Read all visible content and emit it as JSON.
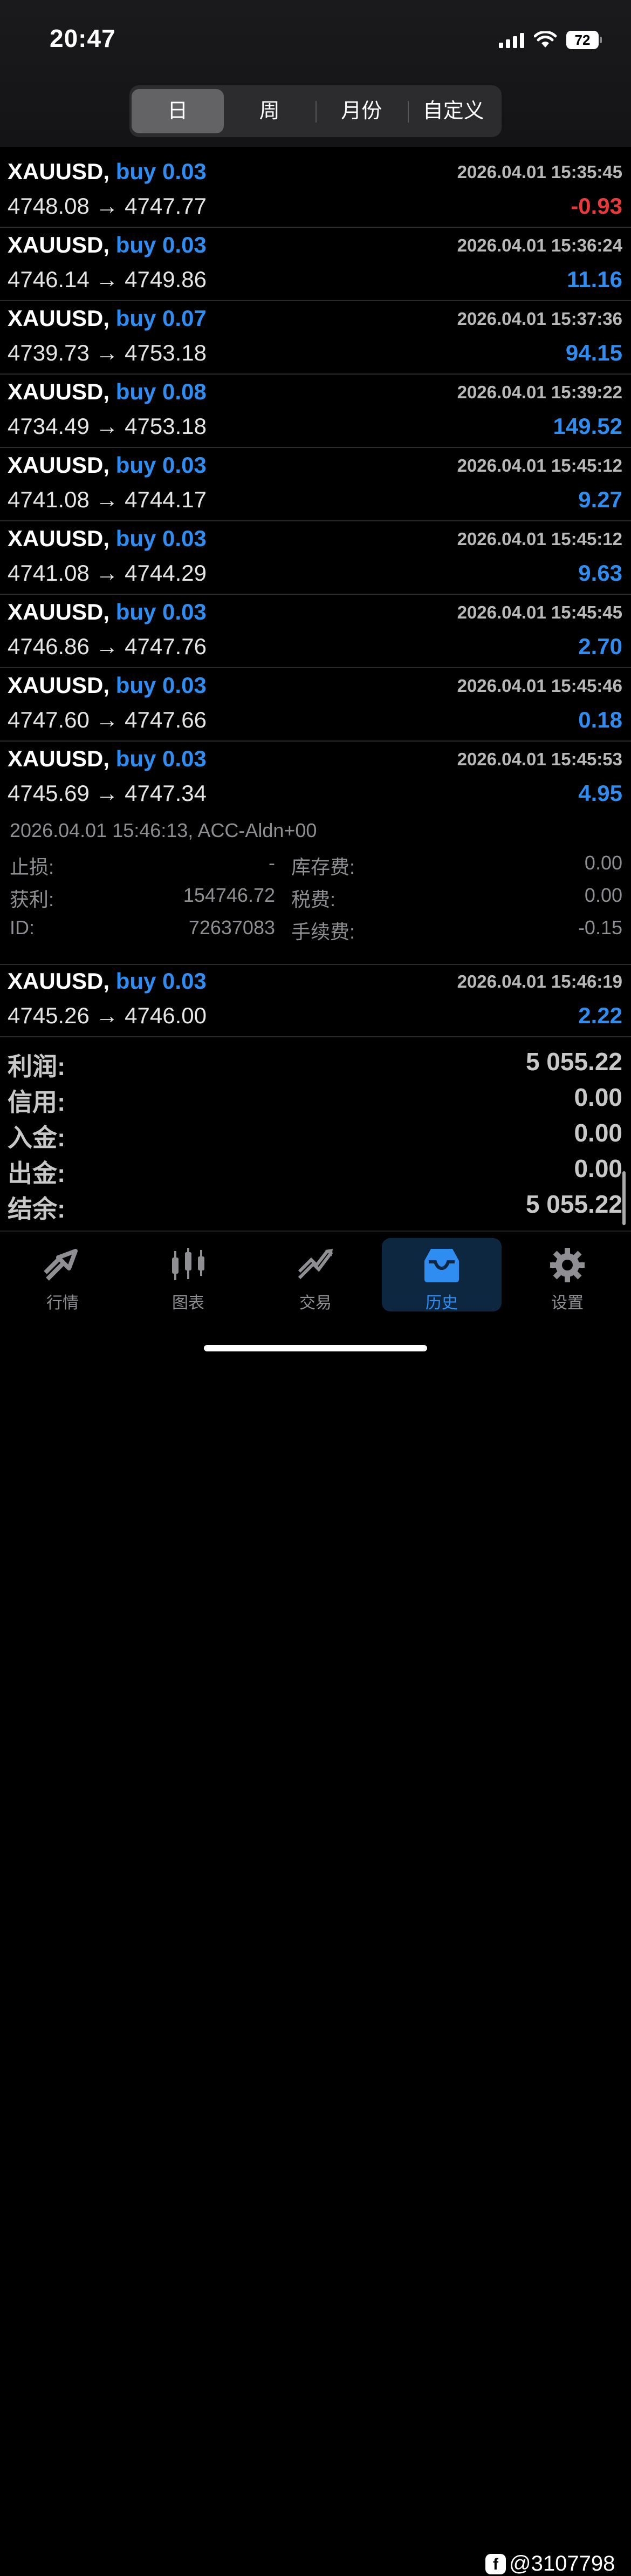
{
  "status_bar": {
    "time": "20:47",
    "battery": "72"
  },
  "segments": [
    "日",
    "周",
    "月份",
    "自定义"
  ],
  "trades": [
    {
      "symbol": "XAUUSD,",
      "side": "buy 0.03",
      "time": "2026.04.01 15:35:45",
      "prices": "4748.08 → 4747.77",
      "profit": "-0.93",
      "negative": true
    },
    {
      "symbol": "XAUUSD,",
      "side": "buy 0.03",
      "time": "2026.04.01 15:36:24",
      "prices": "4746.14 → 4749.86",
      "profit": "11.16",
      "negative": false
    },
    {
      "symbol": "XAUUSD,",
      "side": "buy 0.07",
      "time": "2026.04.01 15:37:36",
      "prices": "4739.73 → 4753.18",
      "profit": "94.15",
      "negative": false
    },
    {
      "symbol": "XAUUSD,",
      "side": "buy 0.08",
      "time": "2026.04.01 15:39:22",
      "prices": "4734.49 → 4753.18",
      "profit": "149.52",
      "negative": false
    },
    {
      "symbol": "XAUUSD,",
      "side": "buy 0.03",
      "time": "2026.04.01 15:45:12",
      "prices": "4741.08 → 4744.17",
      "profit": "9.27",
      "negative": false
    },
    {
      "symbol": "XAUUSD,",
      "side": "buy 0.03",
      "time": "2026.04.01 15:45:12",
      "prices": "4741.08 → 4744.29",
      "profit": "9.63",
      "negative": false
    },
    {
      "symbol": "XAUUSD,",
      "side": "buy 0.03",
      "time": "2026.04.01 15:45:45",
      "prices": "4746.86 → 4747.76",
      "profit": "2.70",
      "negative": false
    },
    {
      "symbol": "XAUUSD,",
      "side": "buy 0.03",
      "time": "2026.04.01 15:45:46",
      "prices": "4747.60 → 4747.66",
      "profit": "0.18",
      "negative": false
    },
    {
      "symbol": "XAUUSD,",
      "side": "buy 0.03",
      "time": "2026.04.01 15:45:53",
      "prices": "4745.69 → 4747.34",
      "profit": "4.95",
      "negative": false
    }
  ],
  "detail": {
    "header": "2026.04.01 15:46:13, ACC-Aldn+00",
    "sl_label": "止损:",
    "sl_value": "-",
    "tp_label": "获利:",
    "tp_value": "154746.72",
    "id_label": "ID:",
    "id_value": "72637083",
    "swap_label": "库存费:",
    "swap_value": "0.00",
    "tax_label": "税费:",
    "tax_value": "0.00",
    "fee_label": "手续费:",
    "fee_value": "-0.15"
  },
  "last_trade": {
    "symbol": "XAUUSD,",
    "side": "buy 0.03",
    "time": "2026.04.01 15:46:19",
    "prices": "4745.26 → 4746.00",
    "profit": "2.22"
  },
  "summary": [
    {
      "label": "利润:",
      "value": "5 055.22"
    },
    {
      "label": "信用:",
      "value": "0.00"
    },
    {
      "label": "入金:",
      "value": "0.00"
    },
    {
      "label": "出金:",
      "value": "0.00"
    },
    {
      "label": "结余:",
      "value": "5 055.22"
    }
  ],
  "tabs": [
    {
      "label": "行情",
      "icon": "quotes-icon"
    },
    {
      "label": "图表",
      "icon": "chart-icon"
    },
    {
      "label": "交易",
      "icon": "trade-icon"
    },
    {
      "label": "历史",
      "icon": "history-icon"
    },
    {
      "label": "设置",
      "icon": "gear-icon"
    }
  ],
  "watermark": "@3107798",
  "colors": {
    "accent": "#2f8cf0",
    "negative": "#e83a3a"
  }
}
